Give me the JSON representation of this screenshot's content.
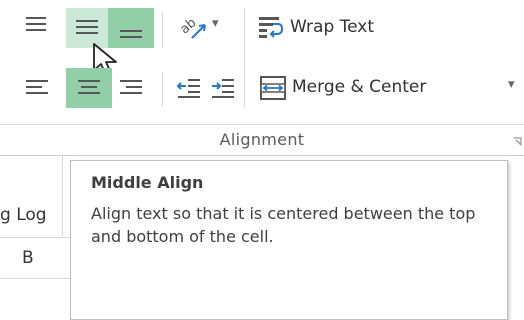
{
  "ribbon": {
    "group_label": "Alignment",
    "wrap_text_label": "Wrap Text",
    "merge_center_label": "Merge & Center",
    "orientation_dropdown": "▾",
    "merge_dropdown": "▾"
  },
  "sheet": {
    "cell_partial_text": "g Log",
    "column_header": "B"
  },
  "tooltip": {
    "title": "Middle Align",
    "body": "Align text so that it is centered between the top and bottom of the cell."
  },
  "colors": {
    "hover_bg": "#cbe9d6",
    "selected_bg": "#92cfa8",
    "icon_line": "#575757",
    "accent_blue": "#2b78c4"
  }
}
